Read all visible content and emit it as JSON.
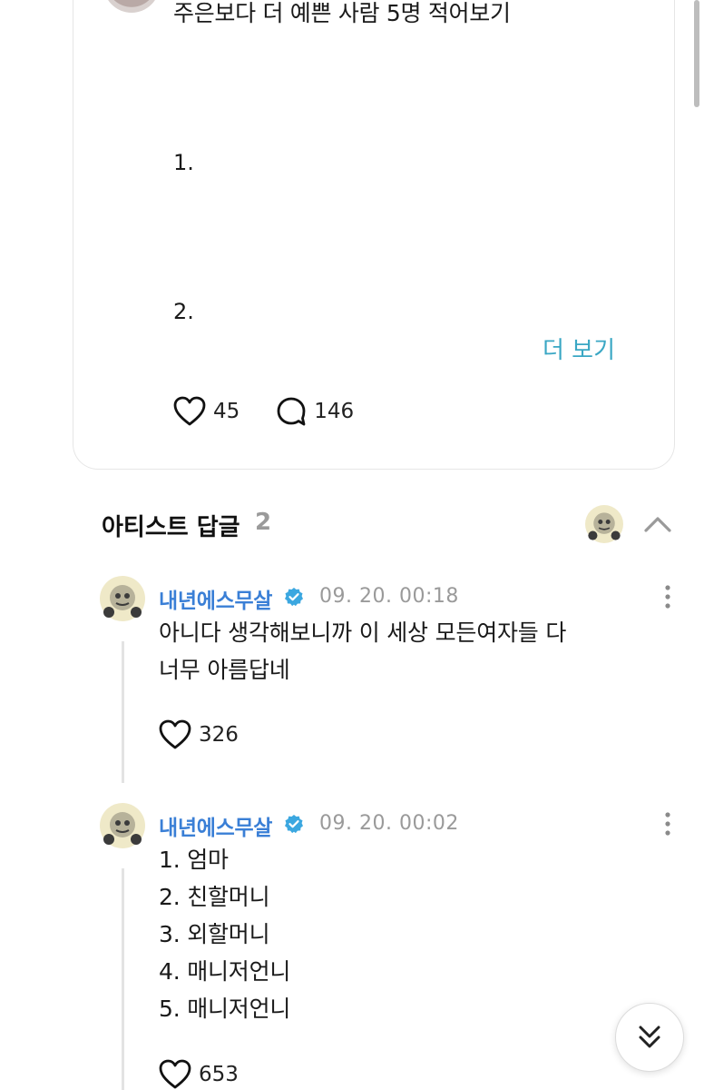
{
  "post": {
    "text": "주은보다 더 예쁜 사람 5명 적어보기",
    "line1": "1.",
    "line2": "2.",
    "more_label": "더 보기",
    "likes": "45",
    "comments": "146"
  },
  "artist_replies": {
    "title": "아티스트 답글",
    "count": "2"
  },
  "replies": [
    {
      "author": "내년에스무살",
      "time": "09. 20. 00:18",
      "body": [
        "아니다 생각해보니까 이 세상 모든여자들 다",
        "너무 아름답네"
      ],
      "likes": "326"
    },
    {
      "author": "내년에스무살",
      "time": "09. 20. 00:02",
      "body": [
        "1. 엄마",
        "2. 친할머니",
        "3. 외할머니",
        "4. 매니저언니",
        "5. 매니저언니"
      ],
      "likes": "653"
    }
  ],
  "colors": {
    "accent_link": "#3aa7c4",
    "author_blue": "#3a7fd6",
    "badge_blue": "#3ba7e0",
    "muted": "#9a9a9a"
  },
  "icons": [
    "heart-icon",
    "comment-icon",
    "verified-badge-icon",
    "more-vertical-icon",
    "chevron-up-icon",
    "chevrons-down-icon"
  ]
}
